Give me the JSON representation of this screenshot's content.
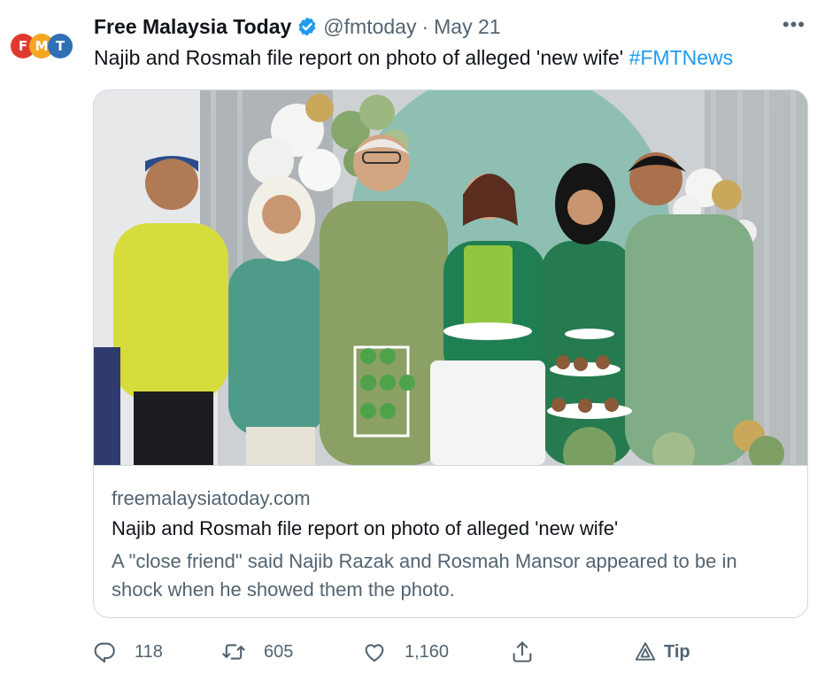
{
  "account": {
    "name": "Free Malaysia Today",
    "handle": "@fmtoday",
    "separator": "·",
    "date": "May 21",
    "avatar_letters": [
      "F",
      "M",
      "T"
    ],
    "avatar_colors": [
      "#e03a2f",
      "#f5a623",
      "#2f6fb5"
    ]
  },
  "more_label": "•••",
  "tweet": {
    "text": "Najib and Rosmah file report on photo of alleged 'new wife'",
    "hashtag": "#FMTNews"
  },
  "card": {
    "domain": "freemalaysiatoday.com",
    "title": "Najib and Rosmah file report on photo of alleged 'new wife'",
    "description": "A \"close friend\" said Najib Razak and Rosmah Mansor appeared to be in shock when he showed them the photo."
  },
  "actions": {
    "replies": "118",
    "retweets": "605",
    "likes": "1,160",
    "tip_label": "Tip"
  },
  "colors": {
    "accent": "#1d9bf0",
    "secondary_text": "#536471",
    "border": "#cfd9de"
  },
  "icons": [
    "verified-badge-icon",
    "more-icon",
    "reply-icon",
    "retweet-icon",
    "like-icon",
    "share-icon",
    "tip-icon"
  ]
}
